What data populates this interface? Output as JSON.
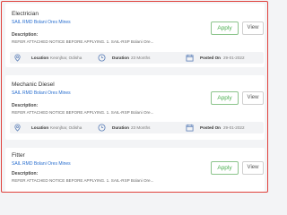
{
  "jobs": [
    {
      "title": "Electrician",
      "company": "SAIL RMD Bolani Ores Mines",
      "description_label": "Description:",
      "description": "REFER ATTACHED NOTICE BEFORE APPLYING. 1. SAIL-RSP Bolani Ore...",
      "apply_label": "Apply",
      "view_label": "View",
      "location_label": "Location",
      "location": "Keonjhar, Odisha",
      "duration_label": "Duration",
      "duration": "23 Months",
      "posted_label": "Posted On",
      "posted_on": "29-01-2022"
    },
    {
      "title": "Mechanic Diesel",
      "company": "SAIL RMD Bolani Ores Mines",
      "description_label": "Description:",
      "description": "REFER ATTACHED NOTICE BEFORE APPLYING. 1. SAIL-RSP Bolani Ore...",
      "apply_label": "Apply",
      "view_label": "View",
      "location_label": "Location",
      "location": "Keonjhar, Odisha",
      "duration_label": "Duration",
      "duration": "23 Months",
      "posted_label": "Posted On",
      "posted_on": "29-01-2022"
    },
    {
      "title": "Fitter",
      "company": "SAIL RMD Bolani Ores Mines",
      "description_label": "Description:",
      "description": "REFER ATTACHED NOTICE BEFORE APPLYING. 1. SAIL-RSP Bolani Ore...",
      "apply_label": "Apply",
      "view_label": "View"
    }
  ],
  "colors": {
    "accent_blue": "#2a6fcf",
    "apply_green": "#4caf50",
    "icon_blue": "#5b7fb8",
    "frame_red": "#e0413c"
  },
  "icons": [
    "location-pin-icon",
    "clock-icon",
    "calendar-icon"
  ]
}
